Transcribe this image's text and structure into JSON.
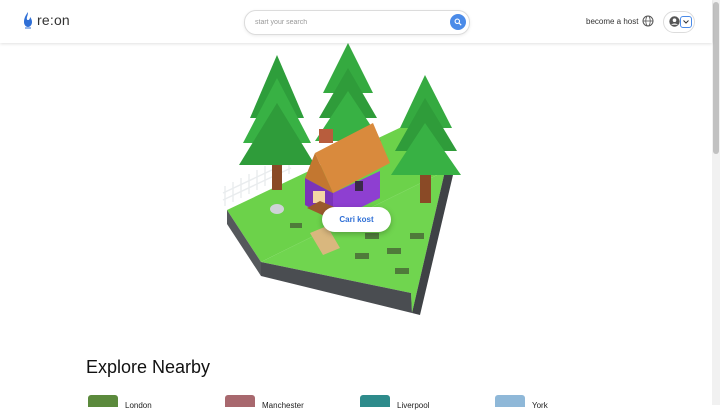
{
  "header": {
    "logo_text": "re:on",
    "search_placeholder": "start your search",
    "host_label": "become a host"
  },
  "hero": {
    "cta_label": "Cari kost"
  },
  "explore": {
    "title": "Explore Nearby",
    "cards": [
      {
        "name": "London",
        "thumb_color": "#5b8a3c"
      },
      {
        "name": "Manchester",
        "thumb_color": "#a8686e"
      },
      {
        "name": "Liverpool",
        "thumb_color": "#2e8b8b"
      },
      {
        "name": "York",
        "thumb_color": "#8fb8d8"
      }
    ]
  },
  "colors": {
    "accent": "#4b8be8",
    "cta_text": "#2f6fd6"
  }
}
